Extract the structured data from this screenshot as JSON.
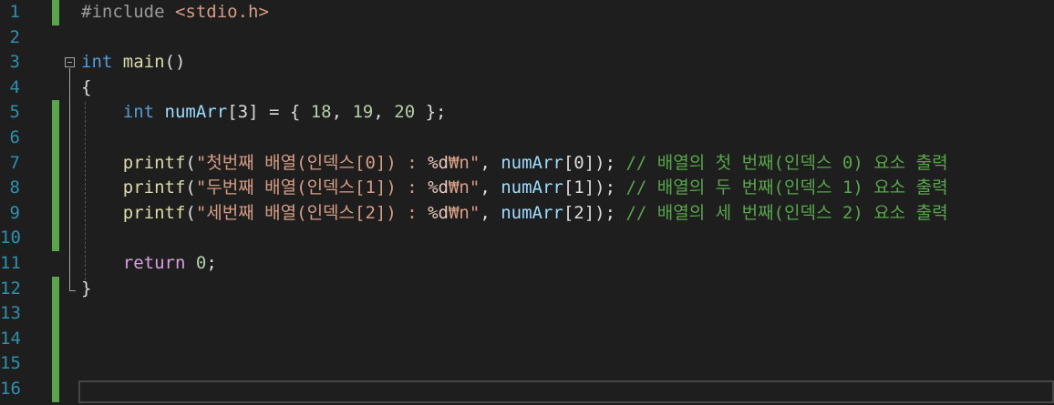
{
  "editor": {
    "language": "C",
    "lines": [
      {
        "number": "1",
        "modified": true,
        "tokens": [
          {
            "t": "pre",
            "v": "#include "
          },
          {
            "t": "str",
            "v": "<stdio.h>"
          }
        ]
      },
      {
        "number": "2",
        "modified": false,
        "tokens": []
      },
      {
        "number": "3",
        "modified": false,
        "tokens": [
          {
            "t": "kw",
            "v": "int"
          },
          {
            "t": "p",
            "v": " "
          },
          {
            "t": "fn",
            "v": "main"
          },
          {
            "t": "p",
            "v": "()"
          }
        ]
      },
      {
        "number": "4",
        "modified": false,
        "tokens": [
          {
            "t": "p",
            "v": "{"
          }
        ]
      },
      {
        "number": "5",
        "modified": true,
        "tokens": [
          {
            "t": "p",
            "v": "    "
          },
          {
            "t": "kw",
            "v": "int"
          },
          {
            "t": "p",
            "v": " "
          },
          {
            "t": "var",
            "v": "numArr"
          },
          {
            "t": "p",
            "v": "[3] = { "
          },
          {
            "t": "num",
            "v": "18"
          },
          {
            "t": "p",
            "v": ", "
          },
          {
            "t": "num",
            "v": "19"
          },
          {
            "t": "p",
            "v": ", "
          },
          {
            "t": "num",
            "v": "20"
          },
          {
            "t": "p",
            "v": " };"
          }
        ]
      },
      {
        "number": "6",
        "modified": true,
        "tokens": []
      },
      {
        "number": "7",
        "modified": true,
        "tokens": [
          {
            "t": "p",
            "v": "    "
          },
          {
            "t": "fn",
            "v": "printf"
          },
          {
            "t": "p",
            "v": "("
          },
          {
            "t": "str",
            "v": "\"첫번째 배열(인덱스[0]) : "
          },
          {
            "t": "fmt",
            "v": "%d"
          },
          {
            "t": "str",
            "v": "₩n\""
          },
          {
            "t": "p",
            "v": ", "
          },
          {
            "t": "var",
            "v": "numArr"
          },
          {
            "t": "p",
            "v": "[0]); "
          },
          {
            "t": "cm",
            "v": "// 배열의 첫 번째(인덱스 0) 요소 출력"
          }
        ]
      },
      {
        "number": "8",
        "modified": true,
        "tokens": [
          {
            "t": "p",
            "v": "    "
          },
          {
            "t": "fn",
            "v": "printf"
          },
          {
            "t": "p",
            "v": "("
          },
          {
            "t": "str",
            "v": "\"두번째 배열(인덱스[1]) : "
          },
          {
            "t": "fmt",
            "v": "%d"
          },
          {
            "t": "str",
            "v": "₩n\""
          },
          {
            "t": "p",
            "v": ", "
          },
          {
            "t": "var",
            "v": "numArr"
          },
          {
            "t": "p",
            "v": "[1]); "
          },
          {
            "t": "cm",
            "v": "// 배열의 두 번째(인덱스 1) 요소 출력"
          }
        ]
      },
      {
        "number": "9",
        "modified": true,
        "tokens": [
          {
            "t": "p",
            "v": "    "
          },
          {
            "t": "fn",
            "v": "printf"
          },
          {
            "t": "p",
            "v": "("
          },
          {
            "t": "str",
            "v": "\"세번째 배열(인덱스[2]) : "
          },
          {
            "t": "fmt",
            "v": "%d"
          },
          {
            "t": "str",
            "v": "₩n\""
          },
          {
            "t": "p",
            "v": ", "
          },
          {
            "t": "var",
            "v": "numArr"
          },
          {
            "t": "p",
            "v": "[2]); "
          },
          {
            "t": "cm",
            "v": "// 배열의 세 번째(인덱스 2) 요소 출력"
          }
        ]
      },
      {
        "number": "10",
        "modified": true,
        "tokens": []
      },
      {
        "number": "11",
        "modified": false,
        "tokens": [
          {
            "t": "p",
            "v": "    "
          },
          {
            "t": "kw2",
            "v": "return"
          },
          {
            "t": "p",
            "v": " "
          },
          {
            "t": "num",
            "v": "0"
          },
          {
            "t": "p",
            "v": ";"
          }
        ]
      },
      {
        "number": "12",
        "modified": true,
        "tokens": [
          {
            "t": "p",
            "v": "}"
          }
        ]
      },
      {
        "number": "13",
        "modified": true,
        "tokens": []
      },
      {
        "number": "14",
        "modified": true,
        "tokens": []
      },
      {
        "number": "15",
        "modified": true,
        "tokens": []
      },
      {
        "number": "16",
        "modified": true,
        "tokens": []
      }
    ],
    "current_line": "16"
  },
  "colors": {
    "background": "#1e1e1e",
    "line_number": "#2b91af",
    "change_bar": "#57a64a",
    "keyword": "#569cd6",
    "control_keyword": "#d8a0df",
    "function": "#dcdcaa",
    "variable": "#9cdcfe",
    "string": "#d69d85",
    "number": "#b5cea8",
    "comment": "#57a64a",
    "preprocessor": "#9b9b9b"
  },
  "icons": {
    "fold": "collapse-minus-icon"
  }
}
